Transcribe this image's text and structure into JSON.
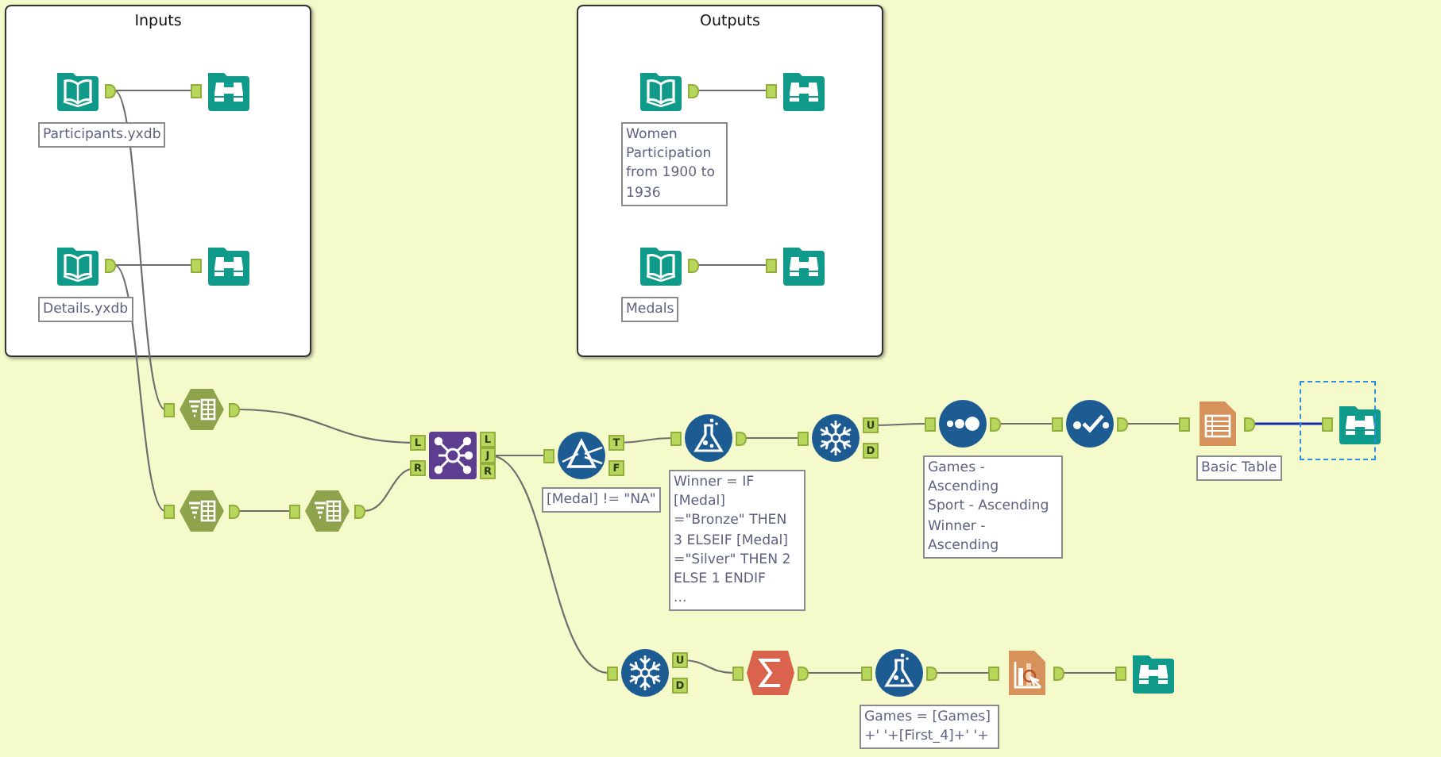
{
  "containers": [
    {
      "title": "Inputs"
    },
    {
      "title": "Outputs"
    }
  ],
  "tools": [
    {
      "kind": "input",
      "annotation": "Participants.yxdb",
      "selected": false
    },
    {
      "kind": "browse",
      "selected": false
    },
    {
      "kind": "input",
      "annotation": "Details.yxdb",
      "selected": false
    },
    {
      "kind": "browse",
      "selected": false
    },
    {
      "kind": "input",
      "annotation": "Women\nParticipation\nfrom 1900 to\n1936",
      "selected": false
    },
    {
      "kind": "browse",
      "selected": false
    },
    {
      "kind": "input",
      "annotation": "Medals",
      "selected": false
    },
    {
      "kind": "browse",
      "selected": false
    },
    {
      "kind": "select",
      "selected": false
    },
    {
      "kind": "select",
      "selected": false
    },
    {
      "kind": "select",
      "selected": false
    },
    {
      "kind": "join",
      "anchors_in": [
        "L",
        "R"
      ],
      "anchors_out": [
        "L",
        "J",
        "R"
      ],
      "selected": false
    },
    {
      "kind": "filter",
      "anchors_out": [
        "T",
        "F"
      ],
      "annotation": "[Medal] != \"NA\"",
      "selected": false
    },
    {
      "kind": "formula",
      "annotation": "Winner = IF\n[Medal]\n=\"Bronze\" THEN\n3 ELSEIF [Medal]\n=\"Silver\" THEN 2\nELSE 1 ENDIF\n...",
      "selected": false
    },
    {
      "kind": "unique",
      "anchors_out": [
        "U",
        "D"
      ],
      "selected": false
    },
    {
      "kind": "sort",
      "annotation": "Games -\nAscending\nSport - Ascending\nWinner -\nAscending",
      "selected": false
    },
    {
      "kind": "sample",
      "selected": false
    },
    {
      "kind": "table",
      "annotation": "Basic Table",
      "selected": false
    },
    {
      "kind": "browse",
      "selected": true
    },
    {
      "kind": "unique",
      "anchors_out": [
        "U",
        "D"
      ],
      "selected": false
    },
    {
      "kind": "summarize",
      "selected": false
    },
    {
      "kind": "formula",
      "annotation": "Games = [Games]\n+' '+[First_4]+' '+",
      "selected": false
    },
    {
      "kind": "render",
      "selected": false
    },
    {
      "kind": "browse",
      "selected": false
    }
  ]
}
